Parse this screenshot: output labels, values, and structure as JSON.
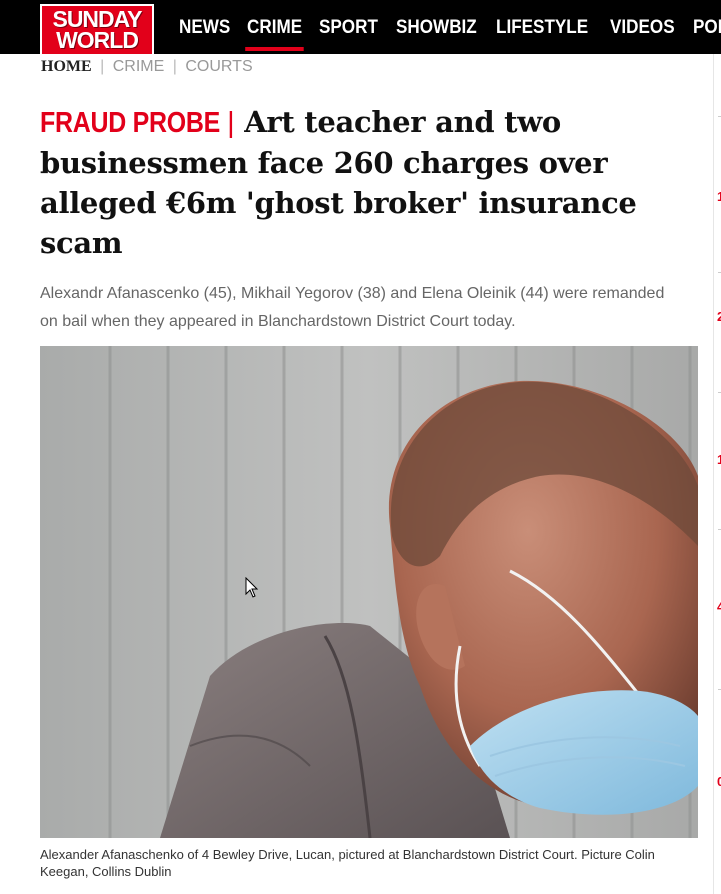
{
  "site": {
    "logo_line1": "SUNDAY",
    "logo_line2": "WORLD",
    "nav": [
      "NEWS",
      "CRIME",
      "SPORT",
      "SHOWBIZ",
      "LIFESTYLE",
      "VIDEOS",
      "POD"
    ],
    "active_nav": "CRIME"
  },
  "breadcrumb": {
    "home": "HOME",
    "items": [
      "CRIME",
      "COURTS"
    ]
  },
  "article": {
    "kicker": "FRAUD PROBE",
    "kicker_sep": "|",
    "headline": "Art teacher and two businessmen face 260 charges over alleged €6m 'ghost broker' insurance scam",
    "standfirst": "Alexandr Afanascenko (45), Mikhail Yegorov (38) and Elena Oleinik (44) were remanded on bail when they appeared in Blanchardstown District Court today.",
    "caption": "Alexander Afanaschenko of 4 Bewley Drive, Lucan, pictured at Blanchardstown District Court. Picture Colin Keegan, Collins Dublin"
  },
  "colors": {
    "brand_red": "#e2001a",
    "nav_bg": "#000000",
    "text": "#111111",
    "muted": "#666666"
  }
}
